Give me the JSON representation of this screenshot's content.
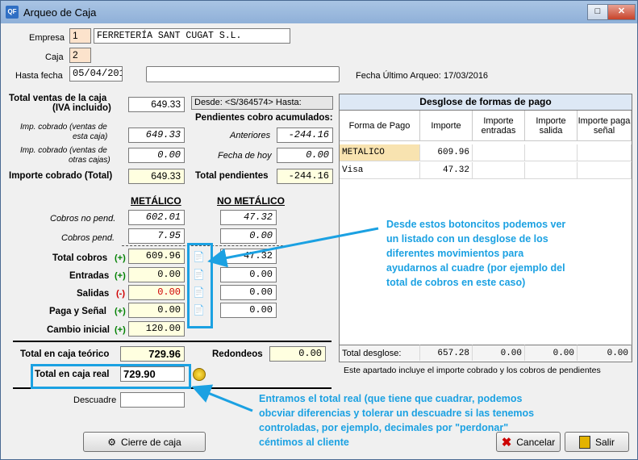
{
  "window": {
    "title": "Arqueo de Caja",
    "app_icon": "QF",
    "minimize": "_",
    "maximize": "□",
    "close": "✕"
  },
  "header": {
    "empresa_label": "Empresa",
    "empresa_code": "1",
    "empresa_name": "FERRETERÍA SANT CUGAT S.L.",
    "caja_label": "Caja",
    "caja_code": "2",
    "hasta_label": "Hasta fecha",
    "hasta_value": "05/04/2016",
    "notes_value": "",
    "ultimo_label": "Fecha Último Arqueo:",
    "ultimo_value": "17/03/2016"
  },
  "totals": {
    "ventas_label_1": "Total ventas de la caja",
    "ventas_label_2": "(IVA incluido)",
    "ventas_value": "649.33",
    "desde_text": "Desde: <S/364574> Hasta:",
    "imp_caja_label_1": "Imp. cobrado (ventas de",
    "imp_caja_label_2": "esta caja)",
    "imp_caja_value": "649.33",
    "imp_otras_label_1": "Imp. cobrado (ventas de",
    "imp_otras_label_2": "otras cajas)",
    "imp_otras_value": "0.00",
    "importe_total_label": "Importe cobrado (Total)",
    "importe_total_value": "649.33",
    "pendientes_label": "Pendientes cobro acumulados:",
    "anteriores_label": "Anteriores",
    "anteriores_value": "-244.16",
    "hoy_label": "Fecha de hoy",
    "hoy_value": "0.00",
    "total_pend_label": "Total pendientes",
    "total_pend_value": "-244.16"
  },
  "cash": {
    "metalico_header": "METÁLICO",
    "no_metalico_header": "NO METÁLICO",
    "no_pend_label": "Cobros no pend.",
    "no_pend_met": "602.01",
    "no_pend_nomet": "47.32",
    "pend_label": "Cobros pend.",
    "pend_met": "7.95",
    "pend_nomet": "0.00",
    "rows": [
      {
        "label": "Total cobros",
        "sign": "(+)",
        "met": "609.96",
        "nomet": "47.32"
      },
      {
        "label": "Entradas",
        "sign": "(+)",
        "met": "0.00",
        "nomet": "0.00"
      },
      {
        "label": "Salidas",
        "sign": "(-)",
        "met": "0.00",
        "nomet": "0.00"
      },
      {
        "label": "Paga y Señal",
        "sign": "(+)",
        "met": "0.00",
        "nomet": "0.00"
      }
    ],
    "cambio_label": "Cambio inicial",
    "cambio_sign": "(+)",
    "cambio_value": "120.00",
    "teorico_label": "Total en caja teórico",
    "teorico_value": "729.96",
    "redondeos_label": "Redondeos",
    "redondeos_value": "0.00",
    "real_label": "Total en caja real",
    "real_value": "729.90",
    "descuadre_label": "Descuadre",
    "descuadre_value": ""
  },
  "desglose": {
    "title": "Desglose de formas de pago",
    "columns": [
      "Forma de Pago",
      "Importe",
      "Importe entradas",
      "Importe salida",
      "Importe paga señal"
    ],
    "rows": [
      {
        "forma": "METALICO",
        "importe": "609.96",
        "entradas": "",
        "salida": "",
        "senal": ""
      },
      {
        "forma": "Visa",
        "importe": "47.32",
        "entradas": "",
        "salida": "",
        "senal": ""
      }
    ],
    "footer_label": "Total desglose:",
    "footer_importe": "657.28",
    "footer_entradas": "0.00",
    "footer_salida": "0.00",
    "footer_senal": "0.00",
    "note": "Este apartado incluye el importe cobrado y los cobros de pendientes"
  },
  "annotations": {
    "top_text": "Desde estos botoncitos podemos ver un listado con un desglose de los diferentes movimientos para ayudarnos al cuadre (por ejemplo del total de cobros en este caso)",
    "bottom_text": "Entramos el total real (que tiene que cuadrar, podemos obcviar diferencias y tolerar un descuadre si las tenemos controladas, por ejemplo, decimales por \"perdonar\" céntimos al cliente"
  },
  "buttons": {
    "cierre": "Cierre de caja",
    "cancelar": "Cancelar",
    "salir": "Salir"
  },
  "colors": {
    "accent_annotation": "#1ba1e2",
    "positive_sign": "#008000",
    "negative_sign": "#d00000"
  }
}
